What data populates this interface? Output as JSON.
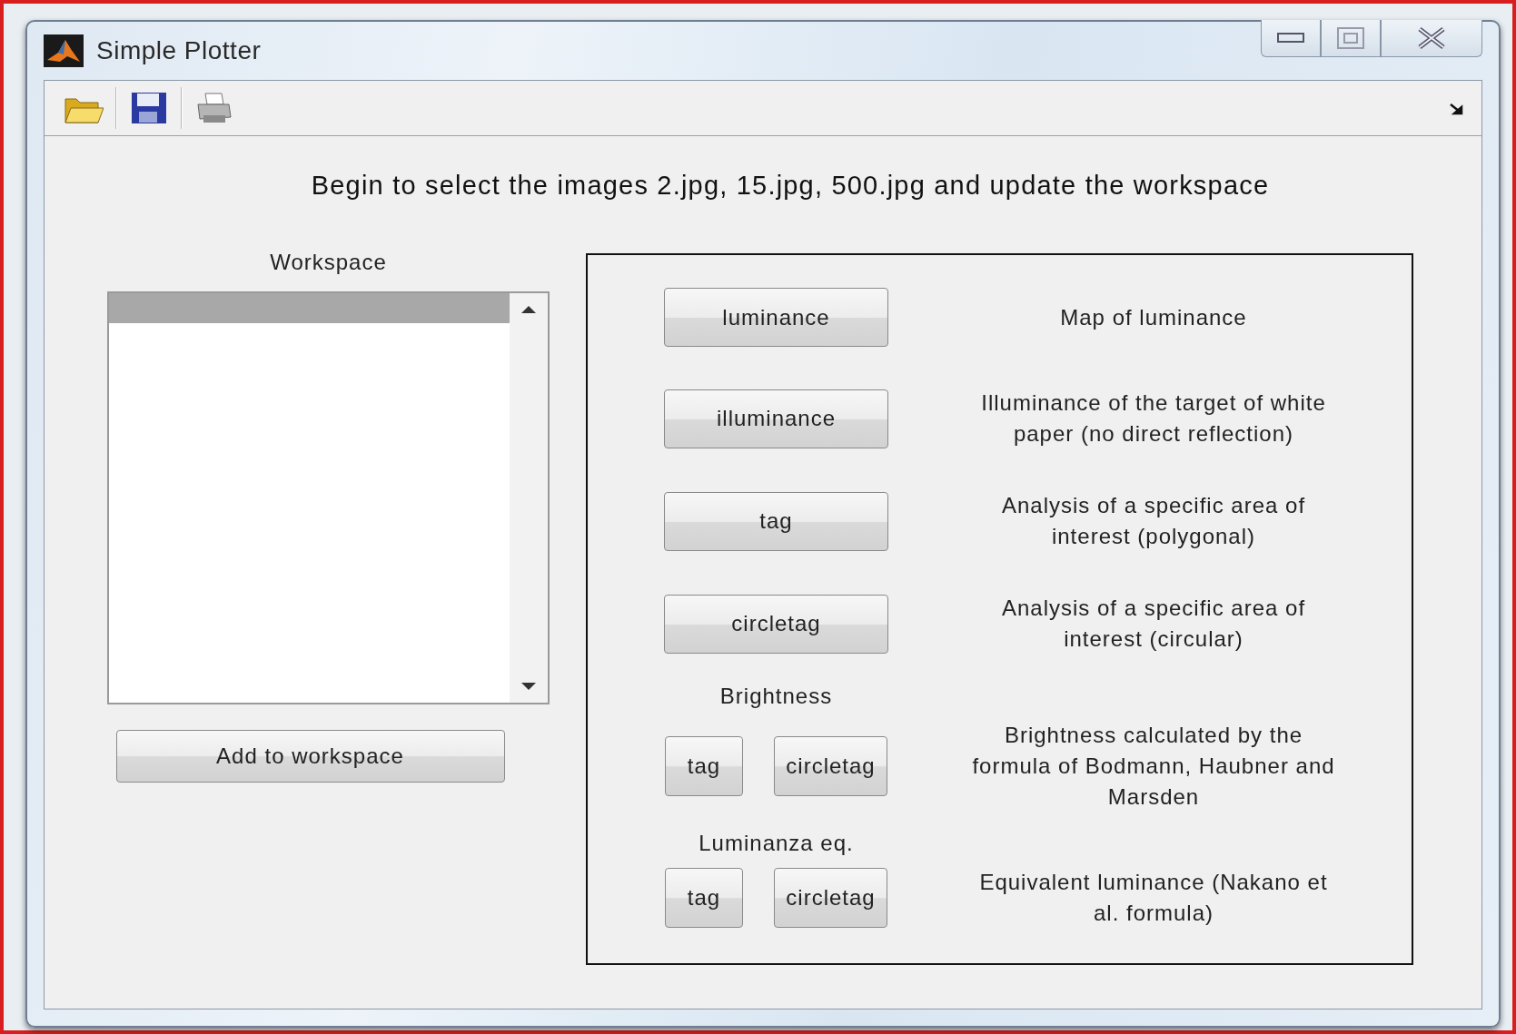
{
  "window": {
    "title": "Simple Plotter"
  },
  "instruction": "Begin to select the images 2.jpg, 15.jpg, 500.jpg and update the workspace",
  "workspace": {
    "label": "Workspace",
    "items": [
      {
        "selected": true
      }
    ],
    "button": "Add to workspace"
  },
  "functions": [
    {
      "button": "luminance",
      "description": "Map of luminance"
    },
    {
      "button": "illuminance",
      "description": "Illuminance of the target of white paper (no direct reflection)"
    },
    {
      "button": "tag",
      "description": "Analysis of a specific area of interest (polygonal)"
    },
    {
      "button": "circletag",
      "description": "Analysis of a specific area of interest (circular)"
    }
  ],
  "groups": [
    {
      "label": "Brightness",
      "buttons": [
        "tag",
        "circletag"
      ],
      "description": "Brightness calculated by the formula of Bodmann, Haubner and Marsden"
    },
    {
      "label": "Luminanza eq.",
      "buttons": [
        "tag",
        "circletag"
      ],
      "description": "Equivalent luminance (Nakano et al. formula)"
    }
  ]
}
